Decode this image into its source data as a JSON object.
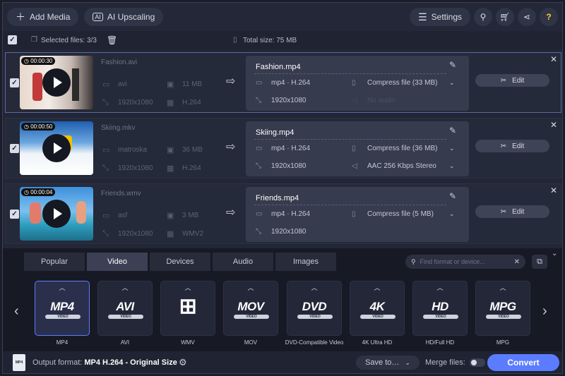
{
  "toolbar": {
    "add_media": "Add Media",
    "ai_upscaling": "AI Upscaling",
    "settings": "Settings"
  },
  "selection": {
    "selected_files": "Selected files: 3/3",
    "total_size": "Total size: 75 MB"
  },
  "files": [
    {
      "timecode": "00:00:30",
      "source_name": "Fashion.avi",
      "container": "avi",
      "size": "11 MB",
      "resolution": "1920x1080",
      "codec": "H.264",
      "output_name": "Fashion.mp4",
      "output_format": "mp4 · H.264",
      "compress": "Compress file (33 MB)",
      "output_resolution": "1920x1080",
      "audio": "No audio",
      "edit": "Edit"
    },
    {
      "timecode": "00:00:50",
      "source_name": "Skiing.mkv",
      "container": "matroska",
      "size": "36 MB",
      "resolution": "1920x1080",
      "codec": "H.264",
      "output_name": "Skiing.mp4",
      "output_format": "mp4 · H.264",
      "compress": "Compress file (36 MB)",
      "output_resolution": "1920x1080",
      "audio": "AAC 256 Kbps Stereo",
      "edit": "Edit"
    },
    {
      "timecode": "00:00:04",
      "source_name": "Friends.wmv",
      "container": "asf",
      "size": "3 MB",
      "resolution": "1920x1080",
      "codec": "WMV2",
      "output_name": "Friends.mp4",
      "output_format": "mp4 · H.264",
      "compress": "Compress file (5 MB)",
      "output_resolution": "1920x1080",
      "audio": "",
      "edit": "Edit"
    }
  ],
  "tabs": [
    "Popular",
    "Video",
    "Devices",
    "Audio",
    "Images"
  ],
  "active_tab": "Video",
  "search": {
    "placeholder": "Find format or device..."
  },
  "formats": [
    {
      "logo": "MP4",
      "sub": "VIDEO",
      "label": "MP4"
    },
    {
      "logo": "AVI",
      "sub": "VIDEO",
      "label": "AVI"
    },
    {
      "logo": "⊞",
      "sub": "",
      "label": "WMV"
    },
    {
      "logo": "MOV",
      "sub": "VIDEO",
      "label": "MOV"
    },
    {
      "logo": "DVD",
      "sub": "VIDEO",
      "label": "DVD-Compatible Video"
    },
    {
      "logo": "4K",
      "sub": "VIDEO",
      "label": "4K Ultra HD"
    },
    {
      "logo": "HD",
      "sub": "VIDEO",
      "label": "HD/Full HD"
    },
    {
      "logo": "MPG",
      "sub": "VIDEO",
      "label": "MPG"
    }
  ],
  "bottom": {
    "icon_text": "MP4",
    "output_label": "Output format:",
    "output_value": "MP4 H.264 - Original Size",
    "save_to": "Save to…",
    "merge_files": "Merge files:",
    "convert": "Convert"
  },
  "colors": {
    "accent": "#5b7cff",
    "help": "#ffd02a"
  }
}
